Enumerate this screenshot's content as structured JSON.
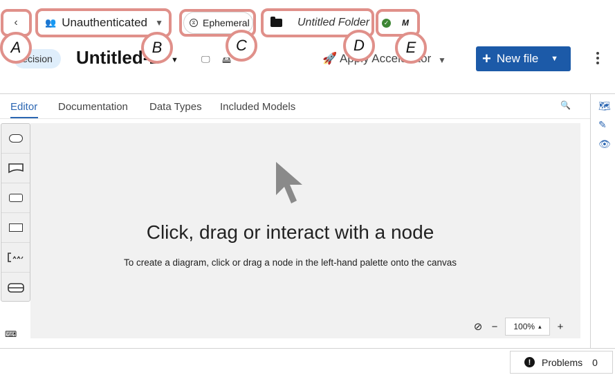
{
  "toolbar": {
    "back_icon": "chevron-left-icon",
    "account_label": "Unauthenticated",
    "account_icon": "users-icon",
    "ephemeral_label": "Ephemeral",
    "folder_label": "Untitled Folder",
    "git_status_label": "M"
  },
  "callouts": [
    "A",
    "B",
    "C",
    "D",
    "E"
  ],
  "header": {
    "badge": "ecision",
    "file_title": "Untitled-1",
    "accelerator_label": "Apply Accelerator",
    "new_file_label": "New file"
  },
  "tabs": [
    {
      "label": "Editor",
      "active": true
    },
    {
      "label": "Documentation",
      "active": false
    },
    {
      "label": "Data Types",
      "active": false
    },
    {
      "label": "Included Models",
      "active": false
    }
  ],
  "side_panel_icons": [
    "map-icon",
    "edit-icon",
    "eye-icon"
  ],
  "palette_items": [
    "start-node-icon",
    "decision-node-icon",
    "context-node-icon",
    "input-data-node-icon",
    "annotation-node-icon",
    "service-node-icon"
  ],
  "canvas": {
    "empty_title": "Click, drag or interact with a node",
    "empty_subtitle": "To create a diagram, click or drag a node in the left-hand palette onto the canvas",
    "zoom_value": "100%"
  },
  "footer": {
    "problems_label": "Problems",
    "problems_count": "0"
  },
  "colors": {
    "accent": "#2b66b2",
    "primary_button": "#1c5aa8",
    "callout_border": "#e0908a",
    "success": "#3e8635"
  }
}
